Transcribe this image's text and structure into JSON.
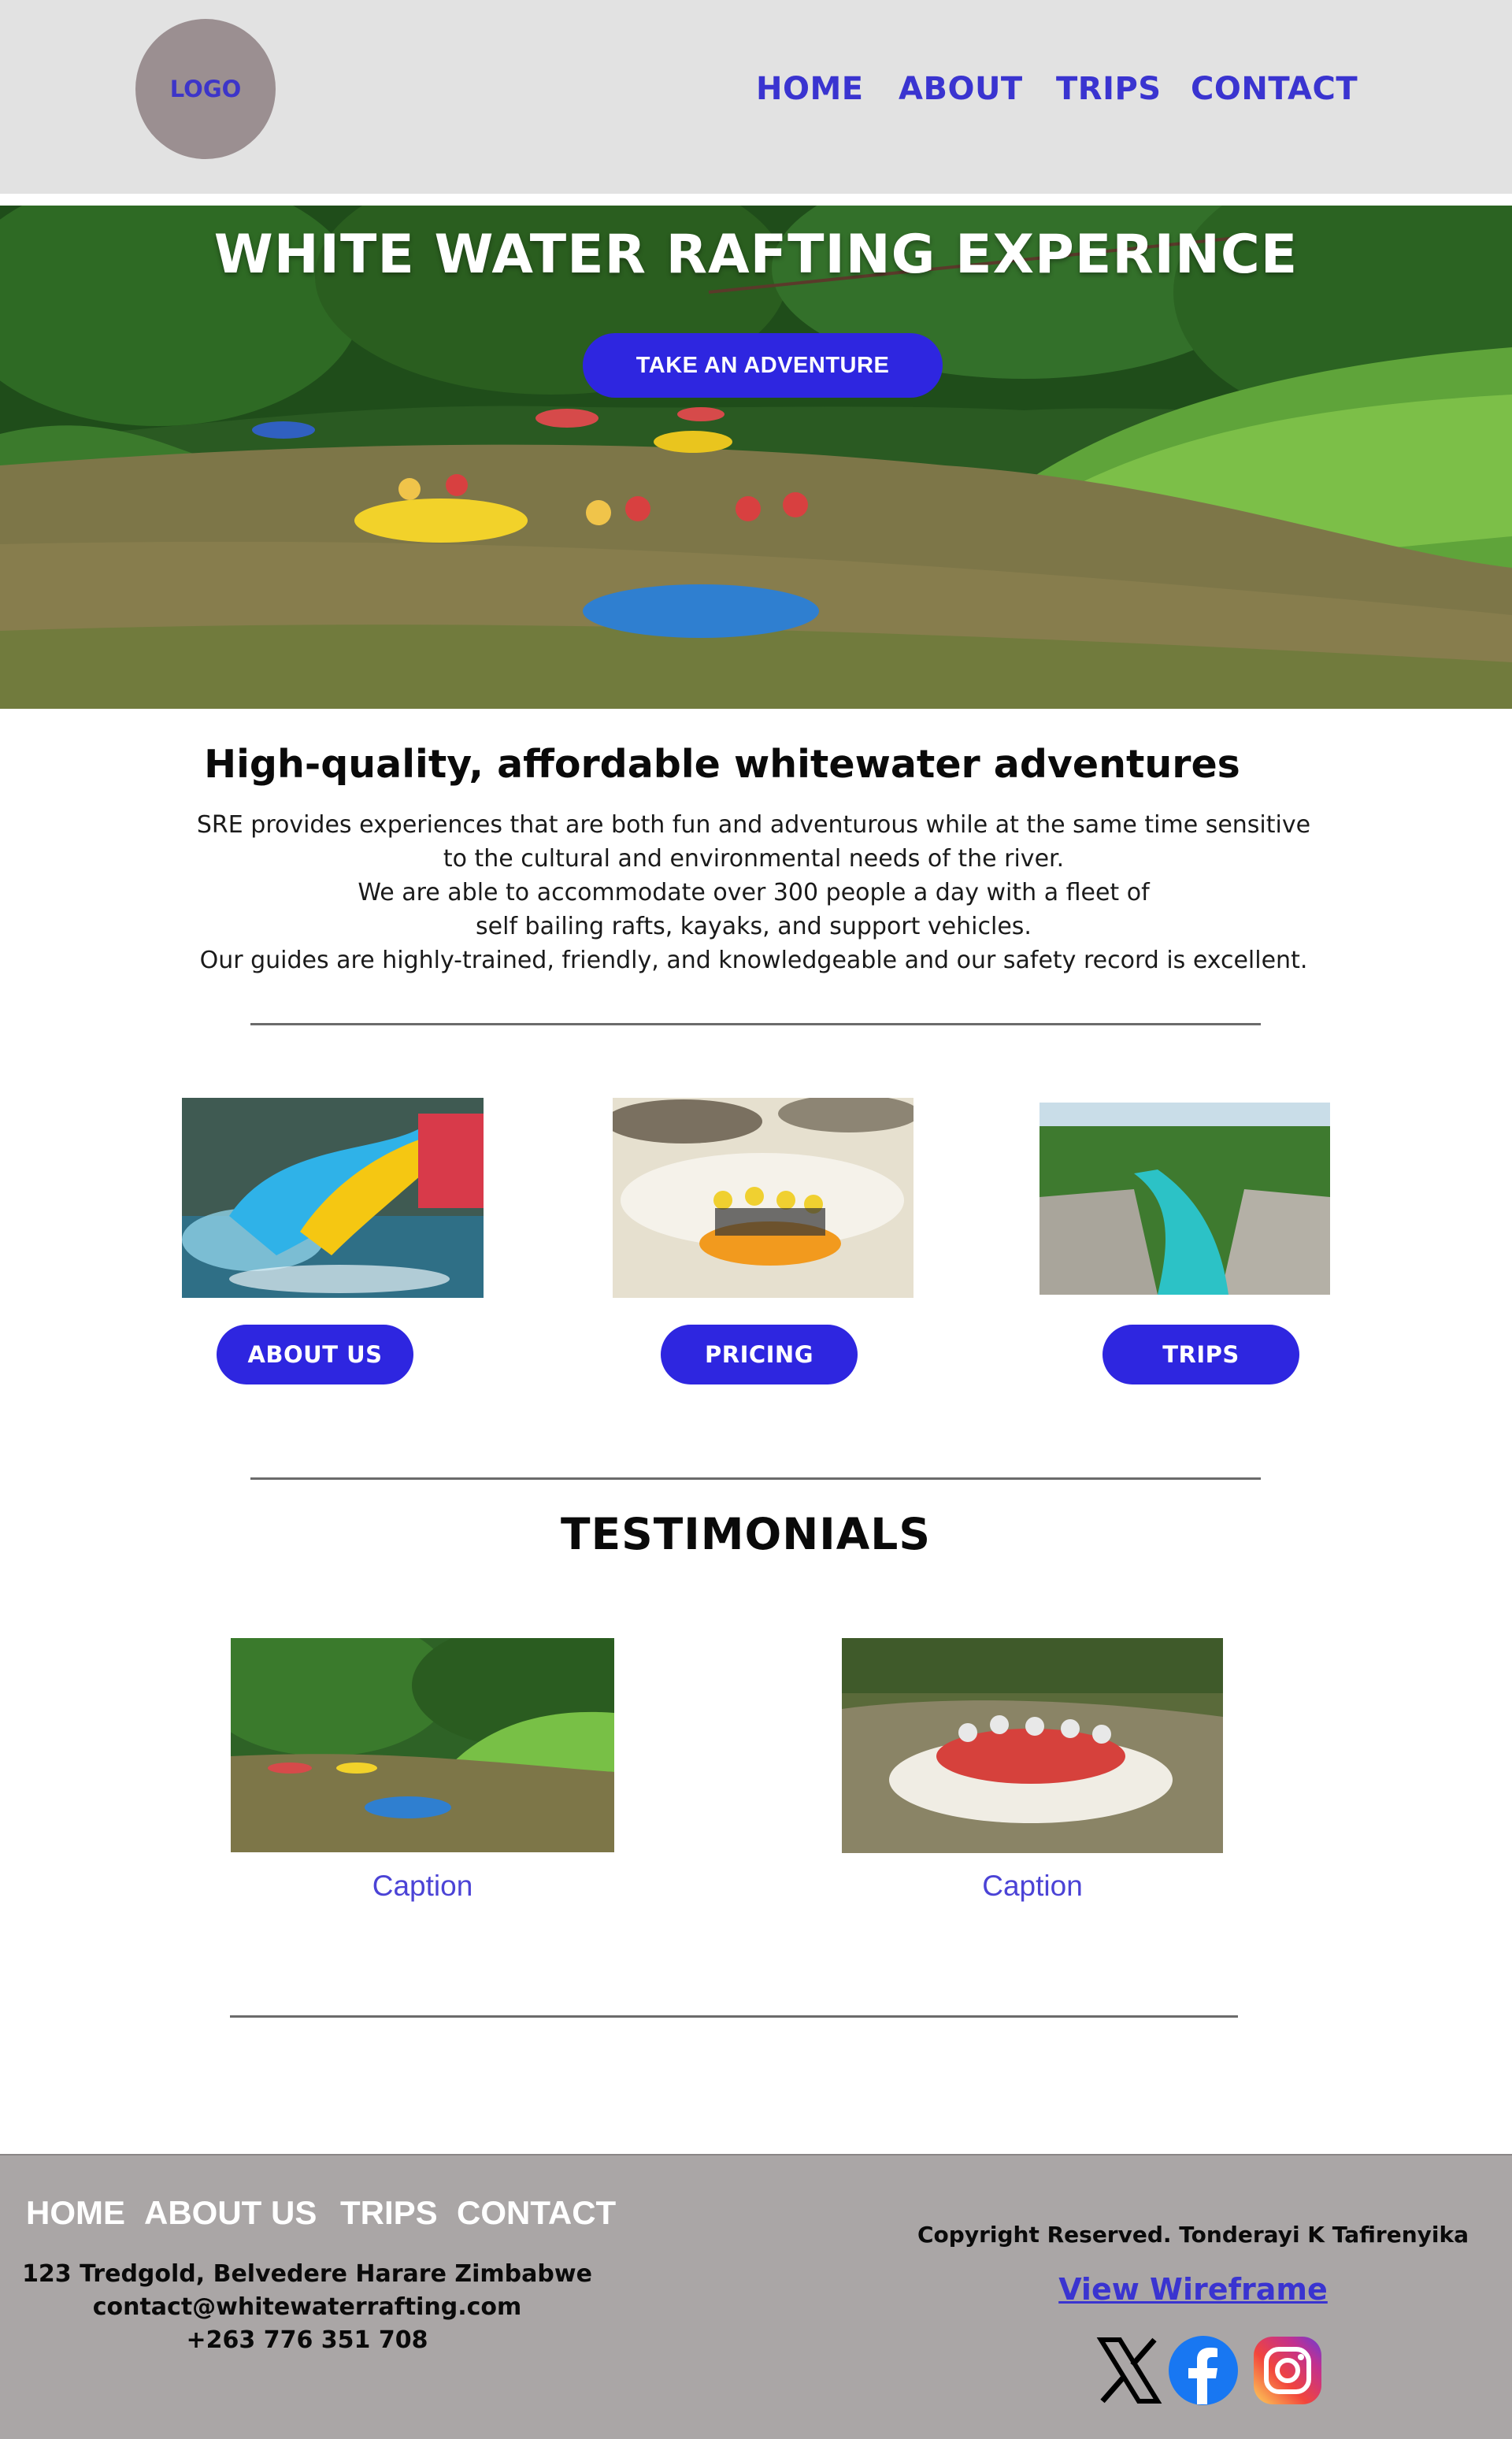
{
  "header": {
    "logo": "LOGO",
    "nav": [
      "HOME",
      "ABOUT",
      "TRIPS",
      "CONTACT"
    ]
  },
  "hero": {
    "title": "WHITE WATER RAFTING EXPERINCE",
    "button": "TAKE AN ADVENTURE"
  },
  "intro": {
    "title": "High-quality, affordable whitewater adventures",
    "lines": [
      "SRE provides experiences that are both fun and adventurous while at the same time sensitive",
      "to the cultural and environmental needs of the river.",
      "We are able to accommodate over 300 people a day with a fleet of",
      "self bailing rafts, kayaks, and support vehicles.",
      "Our guides are highly-trained, friendly, and knowledgeable and our safety record is excellent."
    ]
  },
  "cards": [
    {
      "button": "ABOUT US"
    },
    {
      "button": "PRICING"
    },
    {
      "button": "TRIPS"
    }
  ],
  "testimonials": {
    "title": "TESTIMONIALS",
    "captions": [
      "Caption",
      "Caption"
    ]
  },
  "footer": {
    "nav": [
      "HOME",
      "ABOUT US",
      "TRIPS",
      "CONTACT"
    ],
    "address": [
      "123 Tredgold, Belvedere Harare Zimbabwe",
      "contact@whitewaterrafting.com",
      "+263 776 351 708"
    ],
    "copyright": "Copyright Reserved. Tonderayi K Tafirenyika",
    "wireframe_link": "View Wireframe",
    "social": [
      "x-icon",
      "facebook-icon",
      "instagram-icon"
    ]
  },
  "colors": {
    "accent": "#2e26e0",
    "nav_text": "#3a34d0",
    "header_bg": "#e2e2e2",
    "footer_bg": "#aaa6a6"
  }
}
